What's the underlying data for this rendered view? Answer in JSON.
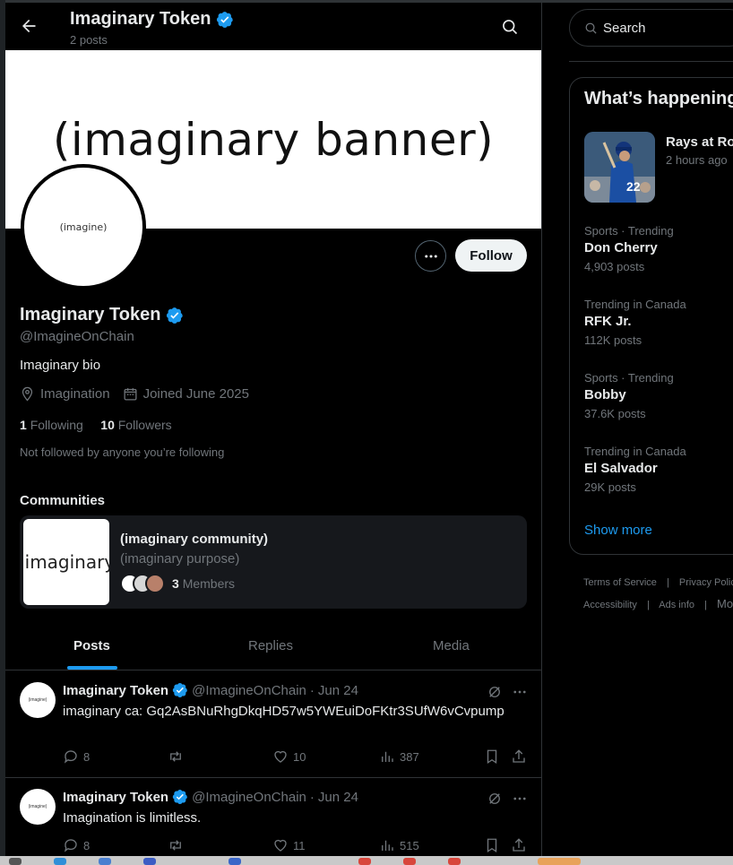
{
  "header": {
    "title": "Imaginary Token",
    "subtitle": "2 posts"
  },
  "profile": {
    "banner_text": "(imaginary banner)",
    "avatar_text": "(imagine)",
    "follow_label": "Follow",
    "name": "Imaginary Token",
    "handle": "@ImagineOnChain",
    "bio": "Imaginary bio",
    "location": "Imagination",
    "joined": "Joined June 2025",
    "following_count": "1",
    "following_label": "Following",
    "followers_count": "10",
    "followers_label": "Followers",
    "not_followed": "Not followed by anyone you’re following"
  },
  "communities": {
    "heading": "Communities",
    "card": {
      "image_text": "(imaginary",
      "name": "(imaginary community)",
      "purpose": "(imaginary purpose)",
      "members_count": "3",
      "members_label": "Members"
    }
  },
  "tabs": [
    "Posts",
    "Replies",
    "Media"
  ],
  "posts": [
    {
      "name": "Imaginary Token",
      "handle": "@ImagineOnChain",
      "sep": "·",
      "date": "Jun 24",
      "text": "imaginary ca: Gq2AsBNuRhgDkqHD57w5YWEuiDoFKtr3SUfW6vCvpump",
      "replies": "8",
      "reposts": "",
      "likes": "10",
      "views": "387",
      "avatar_text": "(imagine)"
    },
    {
      "name": "Imaginary Token",
      "handle": "@ImagineOnChain",
      "sep": "·",
      "date": "Jun 24",
      "text": "Imagination is limitless.",
      "replies": "8",
      "reposts": "",
      "likes": "11",
      "views": "515",
      "avatar_text": "(imagine)"
    }
  ],
  "right": {
    "search_placeholder": "Search",
    "trending_title": "What’s happening",
    "event": {
      "title": "Rays at Ro",
      "time": "2 hours ago",
      "jersey_number": "22"
    },
    "trends": [
      {
        "category": "Sports · Trending",
        "name": "Don Cherry",
        "count": "4,903 posts"
      },
      {
        "category": "Trending in Canada",
        "name": "RFK Jr.",
        "count": "112K posts"
      },
      {
        "category": "Sports · Trending",
        "name": "Bobby",
        "count": "37.6K posts"
      },
      {
        "category": "Trending in Canada",
        "name": "El Salvador",
        "count": "29K posts"
      }
    ],
    "show_more": "Show more",
    "footer": {
      "terms": "Terms of Service",
      "privacy": "Privacy Polic",
      "accessibility": "Accessibility",
      "ads": "Ads info",
      "more": "Mo",
      "sep": "|"
    }
  },
  "colors": {
    "accent": "#1d9bf0",
    "background": "#000000",
    "muted": "#71767b",
    "border": "#2f3336"
  }
}
